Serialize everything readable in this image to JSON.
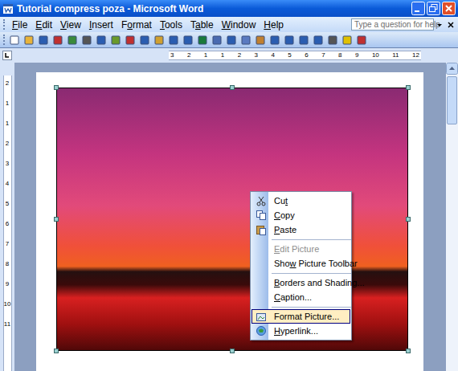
{
  "window": {
    "title": "Tutorial compress poza - Microsoft Word"
  },
  "menu_bar": [
    {
      "label": "File",
      "accelerator": "F"
    },
    {
      "label": "Edit",
      "accelerator": "E"
    },
    {
      "label": "View",
      "accelerator": "V"
    },
    {
      "label": "Insert",
      "accelerator": "I"
    },
    {
      "label": "Format",
      "accelerator": "o"
    },
    {
      "label": "Tools",
      "accelerator": "T"
    },
    {
      "label": "Table",
      "accelerator": "a"
    },
    {
      "label": "Window",
      "accelerator": "W"
    },
    {
      "label": "Help",
      "accelerator": "H"
    }
  ],
  "help_box": {
    "placeholder": "Type a question for help"
  },
  "ruler": {
    "top": [
      "3",
      "2",
      "1",
      "1",
      "2",
      "3",
      "4",
      "5",
      "6",
      "7",
      "8",
      "9",
      "10",
      "11",
      "12"
    ],
    "left": [
      "2",
      "1",
      "1",
      "2",
      "3",
      "4",
      "5",
      "6",
      "7",
      "8",
      "9",
      "10",
      "11"
    ]
  },
  "context_menu": [
    {
      "kind": "item",
      "label": "Cut",
      "accelerator": "t",
      "icon": "cut",
      "disabled": false,
      "selected": false
    },
    {
      "kind": "item",
      "label": "Copy",
      "accelerator": "C",
      "icon": "copy",
      "disabled": false,
      "selected": false
    },
    {
      "kind": "item",
      "label": "Paste",
      "accelerator": "P",
      "icon": "paste",
      "disabled": false,
      "selected": false
    },
    {
      "kind": "separator"
    },
    {
      "kind": "item",
      "label": "Edit Picture",
      "accelerator": "E",
      "icon": "none",
      "disabled": true,
      "selected": false
    },
    {
      "kind": "item",
      "label": "Show Picture Toolbar",
      "accelerator": "w",
      "icon": "none",
      "disabled": false,
      "selected": false
    },
    {
      "kind": "separator"
    },
    {
      "kind": "item",
      "label": "Borders and Shading...",
      "accelerator": "B",
      "icon": "none",
      "disabled": false,
      "selected": false
    },
    {
      "kind": "item",
      "label": "Caption...",
      "accelerator": "C",
      "icon": "none",
      "disabled": false,
      "selected": false
    },
    {
      "kind": "separator"
    },
    {
      "kind": "item",
      "label": "Format Picture...",
      "accelerator": "I",
      "icon": "format",
      "disabled": false,
      "selected": true
    },
    {
      "kind": "item",
      "label": "Hyperlink...",
      "accelerator": "H",
      "icon": "link",
      "disabled": false,
      "selected": false
    }
  ]
}
